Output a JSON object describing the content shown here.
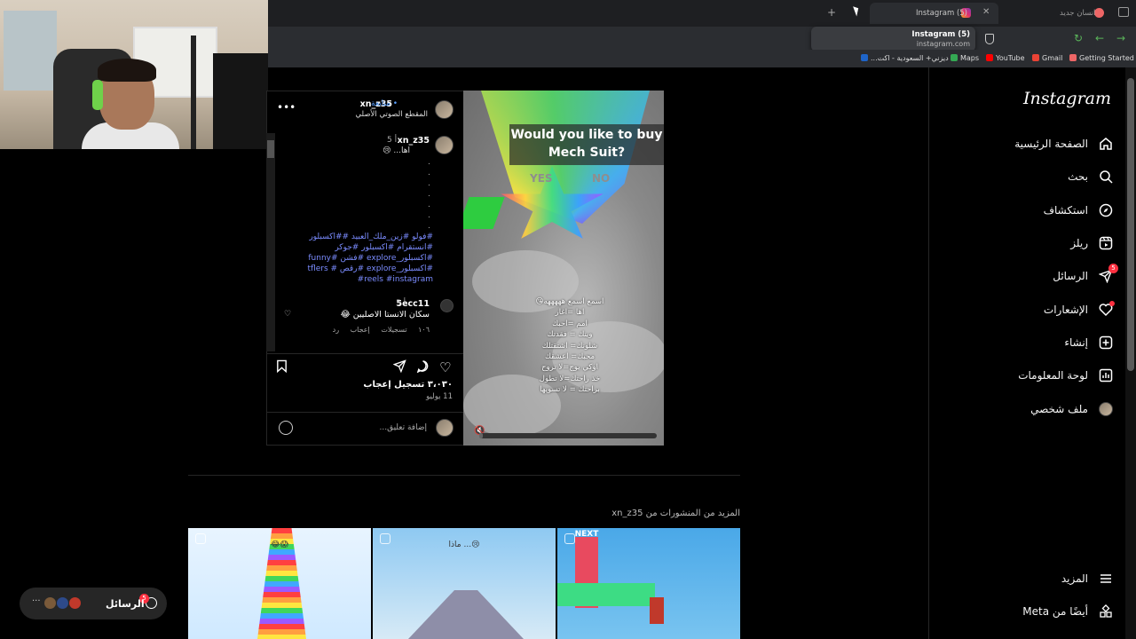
{
  "browser": {
    "tabs": [
      {
        "title": "Instagram (5)",
        "active": true
      },
      {
        "title": "انسان جديد",
        "active": false
      }
    ],
    "url_popup": {
      "title": "Instagram (5)",
      "host": "instagram.com"
    },
    "bookmarks": [
      {
        "label": "Getting Started",
        "color": "#e66"
      },
      {
        "label": "Gmail",
        "color": "#ea4335"
      },
      {
        "label": "YouTube",
        "color": "#ff0000"
      },
      {
        "label": "Maps",
        "color": "#34a853"
      },
      {
        "label": "ديزني+ السعودية - اكت...",
        "color": "#1e64c8"
      }
    ]
  },
  "sidebar": {
    "logo": "Instagram",
    "items": [
      {
        "label": "الصفحة الرئيسية",
        "icon": "home-icon"
      },
      {
        "label": "بحث",
        "icon": "search-icon"
      },
      {
        "label": "استكشاف",
        "icon": "compass-icon"
      },
      {
        "label": "ريلز",
        "icon": "reels-icon"
      },
      {
        "label": "الرسائل",
        "icon": "messages-icon",
        "badge": "5"
      },
      {
        "label": "الإشعارات",
        "icon": "heart-icon",
        "dot": true
      },
      {
        "label": "إنشاء",
        "icon": "create-icon"
      },
      {
        "label": "لوحة المعلومات",
        "icon": "dashboard-icon"
      },
      {
        "label": "ملف شخصي",
        "icon": "profile-avatar"
      }
    ],
    "more": "المزيد",
    "meta": "أيضًا من Meta"
  },
  "post": {
    "header": {
      "username": "xn_z35",
      "follow_status": "• متابعة",
      "audio": "المقطع الصوتي الأصلي"
    },
    "caption": {
      "username": "xn_z35",
      "age": "5 أ",
      "text": "اها... 😢",
      "dots": [
        ".",
        ".",
        ".",
        ".",
        ".",
        ".",
        "."
      ],
      "hashtags": "#فولو #زين_ملك_العبيد ##اكسبلور #انستقرام #اكسبلور #جوكر #اكسبلور_explore #فشن #funny #اكسبلور_explore #رقص # tflers #reels #instagram"
    },
    "comments": [
      {
        "username": "5ecc11",
        "age": "5 أ",
        "text": "سكان الانستا الاصليين 😂",
        "likes": "١٠٦ تسجيلات إعجاب",
        "reply": "رد"
      }
    ],
    "likes": "٣،٠٣٠ تسجيل إعجاب",
    "date": "11 يوليو",
    "comment_placeholder": "إضافة تعليق..."
  },
  "media": {
    "banner": "Would you like to buy Mech Suit?",
    "yes": "YES",
    "no": "NO",
    "overlay_lines": [
      "اسمع اسمع هههههه😘",
      "اها =اغار",
      "امم =احبك",
      "وينك = فقدتك",
      "شلونك= اشتقتلك",
      "محبك= اعشقك",
      "اوكي يوج=لا تروح",
      "خذ راحتك=لا تطول",
      "براحتك = لا تسويها"
    ],
    "progress": 0.02
  },
  "more_posts": {
    "title": "المزيد من المنشورات من xn_z35",
    "thumbnails": [
      {
        "caption": "😂😱"
      },
      {
        "caption": "ماذا ...😢"
      },
      {
        "caption": "NEXT"
      }
    ]
  },
  "messages_pill": {
    "label": "الرسائل",
    "badge": "5",
    "more": "···"
  }
}
